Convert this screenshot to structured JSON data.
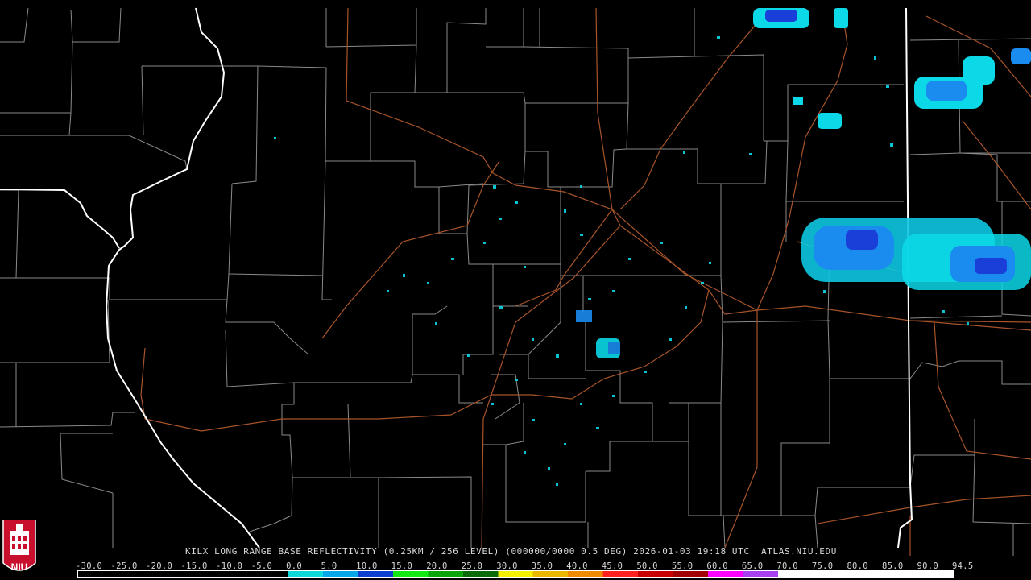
{
  "map": {
    "title": "KILX LONG RANGE BASE REFLECTIVITY (0.25KM / 256 LEVEL) (000000/0000 0.5 DEG) 2026-01-03 19:18 UTC  ATLAS.NIU.EDU",
    "logo_text": "NIU"
  },
  "legend": {
    "ticks": [
      "-30.0",
      "-25.0",
      "-20.0",
      "-15.0",
      "-10.0",
      "-5.0",
      "0.0",
      "5.0",
      "10.0",
      "15.0",
      "20.0",
      "25.0",
      "30.0",
      "35.0",
      "40.0",
      "45.0",
      "50.0",
      "55.0",
      "60.0",
      "65.0",
      "70.0",
      "75.0",
      "80.0",
      "85.0",
      "90.0",
      "94.5"
    ],
    "colors": [
      "#000000",
      "#000000",
      "#000000",
      "#000000",
      "#000000",
      "#000000",
      "#0cd9d9",
      "#08a8e8",
      "#0a3fd0",
      "#14e814",
      "#0aa50a",
      "#0a6b0a",
      "#f4f000",
      "#e8b800",
      "#f08a00",
      "#ff2020",
      "#c80000",
      "#a00000",
      "#ff00ff",
      "#a840f0",
      "#ffffff",
      "#ffffff",
      "#ffffff",
      "#ffffff",
      "#ffffff"
    ]
  },
  "colors": {
    "county_lines": "#8a8a8a",
    "state_lines": "#ffffff",
    "roads": "#a8542a",
    "echo_light": "#0cd9e8",
    "echo_mid": "#1a8cf0",
    "echo_dark": "#1a3fd8"
  }
}
